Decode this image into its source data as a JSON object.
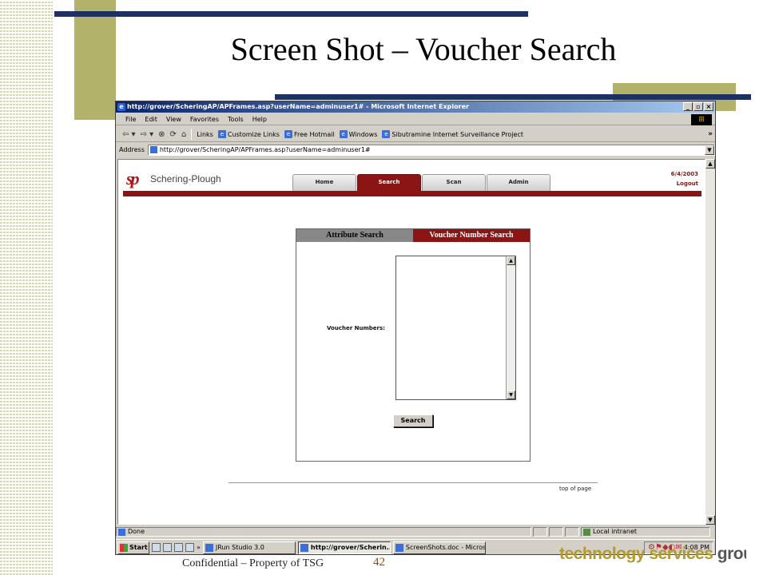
{
  "slide": {
    "title": "Screen Shot – Voucher Search",
    "footer_text": "Confidential – Property of TSG",
    "page_number": "42",
    "logo_text_light": "technology services ",
    "logo_text_dark": "group"
  },
  "browser": {
    "title": "http://grover/ScheringAP/APFrames.asp?userName=adminuser1# - Microsoft Internet Explorer",
    "menu": [
      "File",
      "Edit",
      "View",
      "Favorites",
      "Tools",
      "Help"
    ],
    "links_label": "Links",
    "links": [
      "Customize Links",
      "Free Hotmail",
      "Windows",
      "Sibutramine Internet Surveillance Project"
    ],
    "address_label": "Address",
    "address_url": "http://grover/ScheringAP/APFrames.asp?userName=adminuser1#"
  },
  "app": {
    "logo_text": "Schering-Plough",
    "logo_mark": "sp",
    "nav_tabs": [
      "Home",
      "Search",
      "Scan",
      "Admin"
    ],
    "active_tab": "Search",
    "date": "6/4/2003",
    "logout": "Logout"
  },
  "search_panel": {
    "tabs": [
      "Attribute Search",
      "Voucher Number Search"
    ],
    "active_tab": "Voucher Number Search",
    "voucher_label": "Voucher Numbers:",
    "voucher_value": "",
    "search_button": "Search"
  },
  "footer": {
    "top_of_page": "top of page"
  },
  "status": {
    "text": "Done",
    "zone": "Local intranet"
  },
  "taskbar": {
    "start": "Start",
    "overflow": "»",
    "tasks": [
      "JRun Studio 3.0",
      "http://grover/Scherin...",
      "ScreenShots.doc - Micros..."
    ],
    "active_task": "http://grover/Scherin...",
    "clock": "4:08 PM"
  },
  "colors": {
    "brand_red": "#8b1414",
    "slide_navy": "#1f3162",
    "slide_olive": "#b3b26a"
  }
}
